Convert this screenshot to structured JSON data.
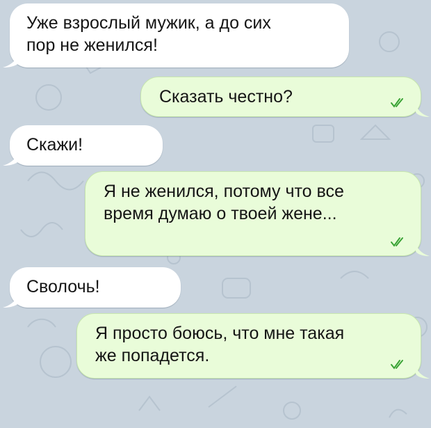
{
  "chat": {
    "messages": [
      {
        "side": "incoming",
        "text": "Уже взрослый мужик, а до сих\nпор не женился!"
      },
      {
        "side": "outgoing",
        "text": "Сказать честно?",
        "read_icon": "double-check-icon"
      },
      {
        "side": "incoming",
        "text": "Скажи!"
      },
      {
        "side": "outgoing",
        "text": "Я не женился, потому что все\nвремя думаю о твоей жене...",
        "read_icon": "double-check-icon"
      },
      {
        "side": "incoming",
        "text": "Сволочь!"
      },
      {
        "side": "outgoing",
        "text": "Я просто боюсь, что мне такая\nже попадется.",
        "read_icon": "double-check-icon"
      }
    ]
  },
  "colors": {
    "wallpaper": "#c9d4de",
    "incoming_bubble": "#ffffff",
    "outgoing_bubble": "#e9fcd9",
    "read_check": "#3aa335"
  }
}
